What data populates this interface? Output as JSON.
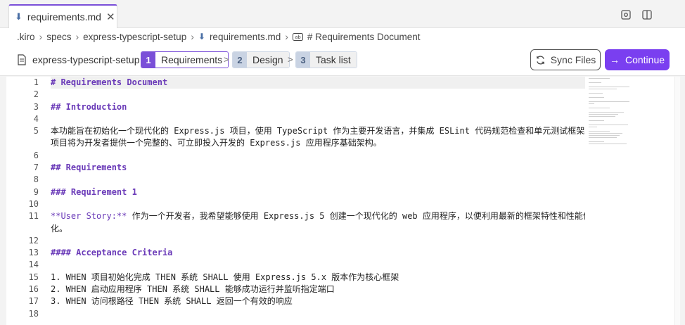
{
  "tab": {
    "label": "requirements.md",
    "close": "✕"
  },
  "breadcrumb": {
    "items": [
      ".kiro",
      "specs",
      "express-typescript-setup",
      "requirements.md",
      "# Requirements Document"
    ]
  },
  "stepper": {
    "spec_name": "express-typescript-setup",
    "steps": [
      {
        "num": "1",
        "label": "Requirements",
        "active": true
      },
      {
        "num": "2",
        "label": "Design",
        "active": false
      },
      {
        "num": "3",
        "label": "Task list",
        "active": false
      }
    ],
    "sync_label": "Sync Files",
    "continue_label": "Continue"
  },
  "editor": {
    "line_numbers": [
      "1",
      "2",
      "3",
      "4",
      "5",
      "",
      "6",
      "7",
      "8",
      "9",
      "10",
      "11",
      "",
      "12",
      "13",
      "14",
      "15",
      "16",
      "17",
      "18"
    ],
    "lines": [
      {
        "text": "# Requirements Document",
        "kind": "heading",
        "hl": true
      },
      {
        "text": "",
        "kind": "plain"
      },
      {
        "text": "## Introduction",
        "kind": "heading"
      },
      {
        "text": "",
        "kind": "plain"
      },
      {
        "text": "本功能旨在初始化一个现代化的 Express.js 项目，使用 TypeScript 作为主要开发语言，并集成 ESLint 代码规范检查和单元测试框架。该",
        "kind": "plain"
      },
      {
        "text": "项目将为开发者提供一个完整的、可立即投入开发的 Express.js 应用程序基础架构。",
        "kind": "plain"
      },
      {
        "text": "",
        "kind": "plain"
      },
      {
        "text": "## Requirements",
        "kind": "heading"
      },
      {
        "text": "",
        "kind": "plain"
      },
      {
        "text": "### Requirement 1",
        "kind": "heading"
      },
      {
        "text": "",
        "kind": "plain"
      },
      {
        "text": "**User Story:** 作为一个开发者，我希望能够使用 Express.js 5 创建一个现代化的 web 应用程序，以便利用最新的框架特性和性能优",
        "kind": "story"
      },
      {
        "text": "化。",
        "kind": "plain"
      },
      {
        "text": "",
        "kind": "plain"
      },
      {
        "text": "#### Acceptance Criteria",
        "kind": "heading"
      },
      {
        "text": "",
        "kind": "plain"
      },
      {
        "text": "1. WHEN 项目初始化完成 THEN 系统 SHALL 使用 Express.js 5.x 版本作为核心框架",
        "kind": "plain"
      },
      {
        "text": "2. WHEN 启动应用程序 THEN 系统 SHALL 能够成功运行并监听指定端口",
        "kind": "plain"
      },
      {
        "text": "3. WHEN 访问根路径 THEN 系统 SHALL 返回一个有效的响应",
        "kind": "plain"
      },
      {
        "text": "",
        "kind": "plain"
      }
    ],
    "story_prefix": "**User Story:**",
    "story_rest": " 作为一个开发者，我希望能够使用 Express.js 5 创建一个现代化的 web 应用程序，以便利用最新的框架特性和性能优"
  },
  "colors": {
    "accent": "#7a3ff0",
    "heading": "#6a3ab8"
  },
  "icons": [
    "markdown-file-icon",
    "close-icon",
    "chevron-right-icon",
    "spec-icon",
    "sync-icon",
    "arrow-right-icon",
    "open-preview-icon",
    "split-editor-icon"
  ]
}
